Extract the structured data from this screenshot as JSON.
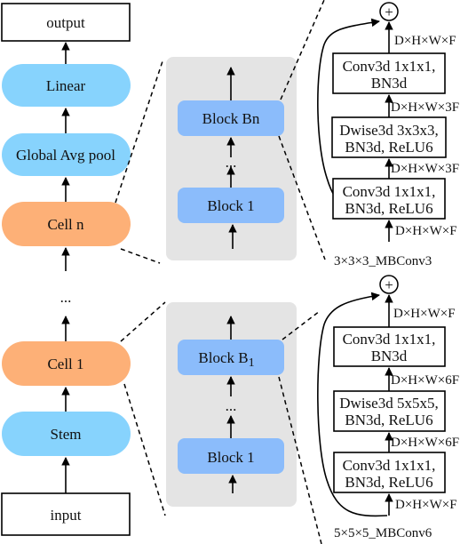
{
  "colors": {
    "light_blue": "#87d3fd",
    "orange": "#fdb077",
    "block_blue": "#8bbcfb",
    "panel_gray": "#e4e4e4",
    "stroke": "#000000"
  },
  "left_column": {
    "output": "output",
    "linear": "Linear",
    "global_avg_pool": "Global Avg pool",
    "cell_n": "Cell n",
    "ellipsis": "...",
    "cell_1": "Cell 1",
    "stem": "Stem",
    "input": "input"
  },
  "top_panel": {
    "block_bn": "Block Bn",
    "ellipsis": "...",
    "block_1": "Block 1"
  },
  "bottom_panel": {
    "block_b1_main": "Block B",
    "block_b1_sub": "1",
    "ellipsis": "...",
    "block_1": "Block 1"
  },
  "top_mbconv": {
    "plus": "+",
    "dim_out": "D×H×W×F",
    "conv_out_line1": "Conv3d 1x1x1,",
    "conv_out_line2": "BN3d",
    "dim_mid1": "D×H×W×3F",
    "dwise_line1": "Dwise3d 3x3x3,",
    "dwise_line2": "BN3d, ReLU6",
    "dim_mid2": "D×H×W×3F",
    "conv_in_line1": "Conv3d 1x1x1,",
    "conv_in_line2": "BN3d, ReLU6",
    "dim_in": "D×H×W×F",
    "caption": "3×3×3_MBConv3"
  },
  "bottom_mbconv": {
    "plus": "+",
    "dim_out": "D×H×W×F",
    "conv_out_line1": "Conv3d 1x1x1,",
    "conv_out_line2": "BN3d",
    "dim_mid1": "D×H×W×6F",
    "dwise_line1": "Dwise3d 5x5x5,",
    "dwise_line2": "BN3d, ReLU6",
    "dim_mid2": "D×H×W×6F",
    "conv_in_line1": "Conv3d 1x1x1,",
    "conv_in_line2": "BN3d, ReLU6",
    "dim_in": "D×H×W×F",
    "caption": "5×5×5_MBConv6"
  }
}
